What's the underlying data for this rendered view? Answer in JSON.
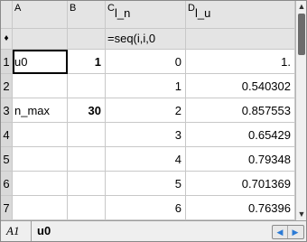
{
  "columns": {
    "A": {
      "letter": "A",
      "name": ""
    },
    "B": {
      "letter": "B",
      "name": ""
    },
    "C": {
      "letter": "C",
      "name": "l_n"
    },
    "D": {
      "letter": "D",
      "name": "l_u"
    }
  },
  "formula_row": {
    "marker": "♦",
    "C": "=seq(i,i,0"
  },
  "rows": [
    {
      "num": "1",
      "A": "u0",
      "B": "1",
      "C": "0",
      "D": "1."
    },
    {
      "num": "2",
      "A": "",
      "B": "",
      "C": "1",
      "D": "0.540302"
    },
    {
      "num": "3",
      "A": "n_max",
      "B": "30",
      "C": "2",
      "D": "0.857553"
    },
    {
      "num": "4",
      "A": "",
      "B": "",
      "C": "3",
      "D": "0.65429"
    },
    {
      "num": "5",
      "A": "",
      "B": "",
      "C": "4",
      "D": "0.79348"
    },
    {
      "num": "6",
      "A": "",
      "B": "",
      "C": "5",
      "D": "0.701369"
    },
    {
      "num": "7",
      "A": "",
      "B": "",
      "C": "6",
      "D": "0.76396"
    }
  ],
  "bottom_bar": {
    "cell_ref": "A1",
    "cell_value": "u0"
  },
  "icons": {
    "scroll_up": "▲",
    "scroll_down": "▼",
    "nav_left": "◀",
    "nav_right": "▶"
  }
}
